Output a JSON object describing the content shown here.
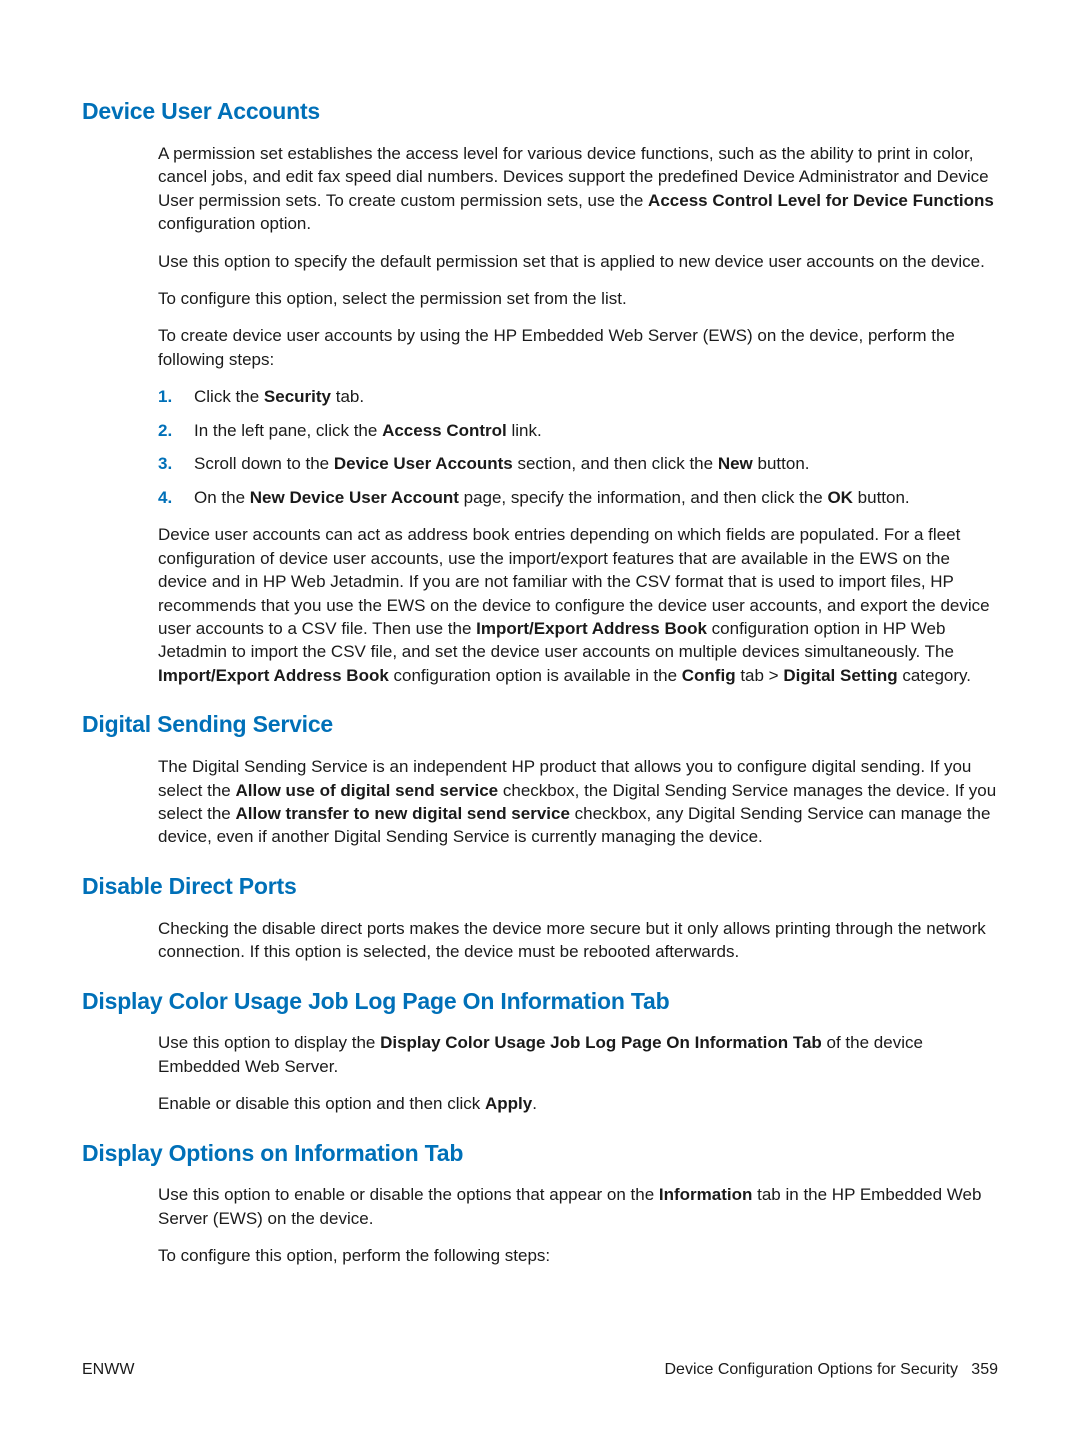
{
  "sections": {
    "s1": {
      "title": "Device User Accounts",
      "p1a": "A permission set establishes the access level for various device functions, such as the ability to print in color, cancel jobs, and edit fax speed dial numbers. Devices support the predefined Device Administrator and Device User permission sets. To create custom permission sets, use the ",
      "p1b": "Access Control Level for Device Functions",
      "p1c": " configuration option.",
      "p2": "Use this option to specify the default permission set that is applied to new device user accounts on the device.",
      "p3": "To configure this option, select the permission set from the list.",
      "p4": "To create device user accounts by using the HP Embedded Web Server (EWS) on the device, perform the following steps:",
      "step1a": "Click the ",
      "step1b": "Security",
      "step1c": " tab.",
      "step2a": "In the left pane, click the ",
      "step2b": "Access Control",
      "step2c": " link.",
      "step3a": "Scroll down to the ",
      "step3b": "Device User Accounts",
      "step3c": " section, and then click the ",
      "step3d": "New",
      "step3e": " button.",
      "step4a": "On the ",
      "step4b": "New Device User Account",
      "step4c": " page, specify the information, and then click the ",
      "step4d": "OK",
      "step4e": " button.",
      "p5a": "Device user accounts can act as address book entries depending on which fields are populated. For a fleet configuration of device user accounts, use the import/export features that are available in the EWS on the device and in HP Web Jetadmin. If you are not familiar with the CSV format that is used to import files, HP recommends that you use the EWS on the device to configure the device user accounts, and export the device user accounts to a CSV file. Then use the ",
      "p5b": "Import/Export Address Book",
      "p5c": " configuration option in HP Web Jetadmin to import the CSV file, and set the device user accounts on multiple devices simultaneously. The ",
      "p5d": "Import/Export Address Book",
      "p5e": " configuration option is available in the ",
      "p5f": "Config",
      "p5g": " tab > ",
      "p5h": "Digital Setting",
      "p5i": " category."
    },
    "s2": {
      "title": "Digital Sending Service",
      "p1a": "The Digital Sending Service is an independent HP product that allows you to configure digital sending. If you select the ",
      "p1b": "Allow use of digital send service",
      "p1c": " checkbox, the Digital Sending Service manages the device. If you select the ",
      "p1d": "Allow transfer to new digital send service",
      "p1e": " checkbox, any Digital Sending Service can manage the device, even if another Digital Sending Service is currently managing the device."
    },
    "s3": {
      "title": "Disable Direct Ports",
      "p1": "Checking the disable direct ports makes the device more secure but it only allows printing through the network connection. If this option is selected, the device must be rebooted afterwards."
    },
    "s4": {
      "title": "Display Color Usage Job Log Page On Information Tab",
      "p1a": "Use this option to display the ",
      "p1b": "Display Color Usage Job Log Page On Information Tab",
      "p1c": " of the device Embedded Web Server.",
      "p2a": "Enable or disable this option and then click ",
      "p2b": "Apply",
      "p2c": "."
    },
    "s5": {
      "title": "Display Options on Information Tab",
      "p1a": "Use this option to enable or disable the options that appear on the ",
      "p1b": "Information",
      "p1c": " tab in the HP Embedded Web Server (EWS) on the device.",
      "p2": "To configure this option, perform the following steps:"
    }
  },
  "nums": {
    "n1": "1.",
    "n2": "2.",
    "n3": "3.",
    "n4": "4."
  },
  "footer": {
    "left": "ENWW",
    "right_label": "Device Configuration Options for Security",
    "right_page": "359"
  }
}
